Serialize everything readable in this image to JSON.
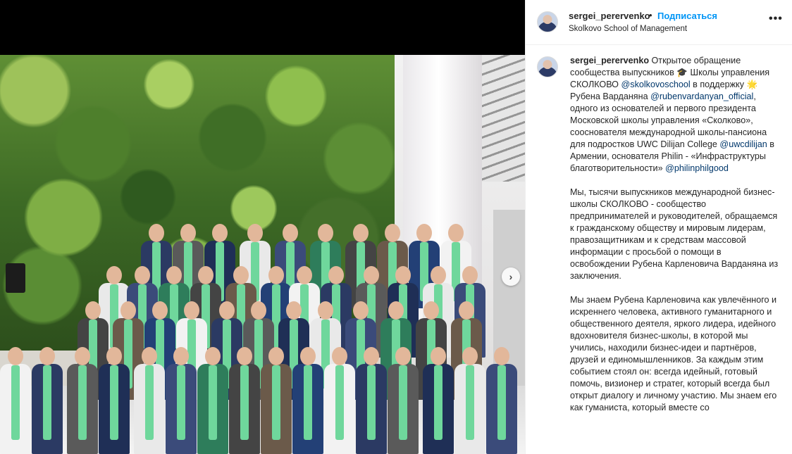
{
  "header": {
    "username": "sergei_perervenko",
    "separator": "•",
    "follow_label": "Подписаться",
    "location": "Skolkovo School of Management",
    "more_icon": "more-horizontal-icon"
  },
  "caption": {
    "username": "sergei_perervenko",
    "p1": [
      {
        "t": "text",
        "v": " Открытое обращение сообщества выпускников 🎓 Школы управления СКОЛКОВО "
      },
      {
        "t": "mention",
        "v": "@skolkovoschool"
      },
      {
        "t": "text",
        "v": " в поддержку 🌟 Рубена Варданяна "
      },
      {
        "t": "mention",
        "v": "@rubenvardanyan_official"
      },
      {
        "t": "text",
        "v": ", одного из основателей и первого президента Московской школы управления «Сколково», сооснователя международной школы-пансиона для подростков UWC Dilijan College "
      },
      {
        "t": "mention",
        "v": "@uwcdilijan"
      },
      {
        "t": "text",
        "v": " в Армении, основателя Philin - «Инфраструктуры благотворительности» "
      },
      {
        "t": "mention",
        "v": "@philinphilgood"
      }
    ],
    "p2": "Мы, тысячи выпускников международной бизнес-школы СКОЛКОВО - сообщество предпринимателей и руководителей, обращаемся к гражданскому обществу и мировым лидерам, правозащитникам и к средствам массовой информации с просьбой о помощи в освобождении Рубена Карленовича Варданяна из заключения.",
    "p3": "Мы знаем Рубена Карленовича как увлечённого и искреннего человека, активного гуманитарного и общественного деятеля, яркого лидера, идейного вдохновителя бизнес-школы, в которой мы учились, находили бизнес-идеи и партнёров, друзей и единомышленников. За каждым этим событием стоял он: всегда идейный, готовый помочь, визионер и стратег, который всегда был открыт диалогу и личному участию. Мы знаем его как гуманиста, который вместе со"
  },
  "photo": {
    "alt_icon": "group-photo-image",
    "next_icon": "chevron-right-icon",
    "next_glyph": "›"
  },
  "colors": {
    "accent": "#0095f6",
    "mention": "#00376b",
    "text": "#262626",
    "scarf": "#6fd79c"
  }
}
